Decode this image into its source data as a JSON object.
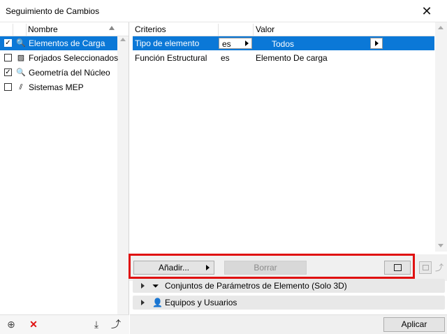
{
  "window": {
    "title": "Seguimiento de Cambios",
    "close_glyph": "✕"
  },
  "left_panel": {
    "column_header": "Nombre",
    "items": [
      {
        "label": "Elementos de Carga",
        "checked": true,
        "selected": true,
        "icon": "magnifier-element-icon",
        "icon_glyph": "🔍"
      },
      {
        "label": "Forjados Seleccionados",
        "checked": false,
        "selected": false,
        "icon": "slab-hatch-icon",
        "icon_glyph": "▨"
      },
      {
        "label": "Geometría del Núcleo",
        "checked": true,
        "selected": false,
        "icon": "magnifier-element-icon",
        "icon_glyph": "🔍"
      },
      {
        "label": "Sistemas MEP",
        "checked": false,
        "selected": false,
        "icon": "mep-systems-icon",
        "icon_glyph": "⫽"
      }
    ],
    "footer": {
      "new_glyph": "⊕",
      "delete_glyph": "✕",
      "import_glyph": "⤓",
      "export_glyph": "⤴"
    }
  },
  "criteria": {
    "headers": {
      "criterion": "Criterios",
      "value": "Valor"
    },
    "rows": [
      {
        "criterion": "Tipo de elemento",
        "operator": "es",
        "value": "Todos",
        "selected": true
      },
      {
        "criterion": "Función Estructural",
        "operator": "es",
        "value": "Elemento De carga",
        "selected": false
      }
    ]
  },
  "actions": {
    "add_label": "Añadir...",
    "delete_label": "Borrar",
    "undo_glyph": "⤴"
  },
  "sections": [
    {
      "label": "Conjuntos de Parámetros de Elemento (Solo 3D)",
      "icon_glyph": "⏷"
    },
    {
      "label": "Equipos y Usuarios",
      "icon_glyph": "👤"
    }
  ],
  "footer": {
    "apply_label": "Aplicar"
  },
  "colors": {
    "selection": "#0b78d7",
    "highlight_box": "#e01010"
  }
}
